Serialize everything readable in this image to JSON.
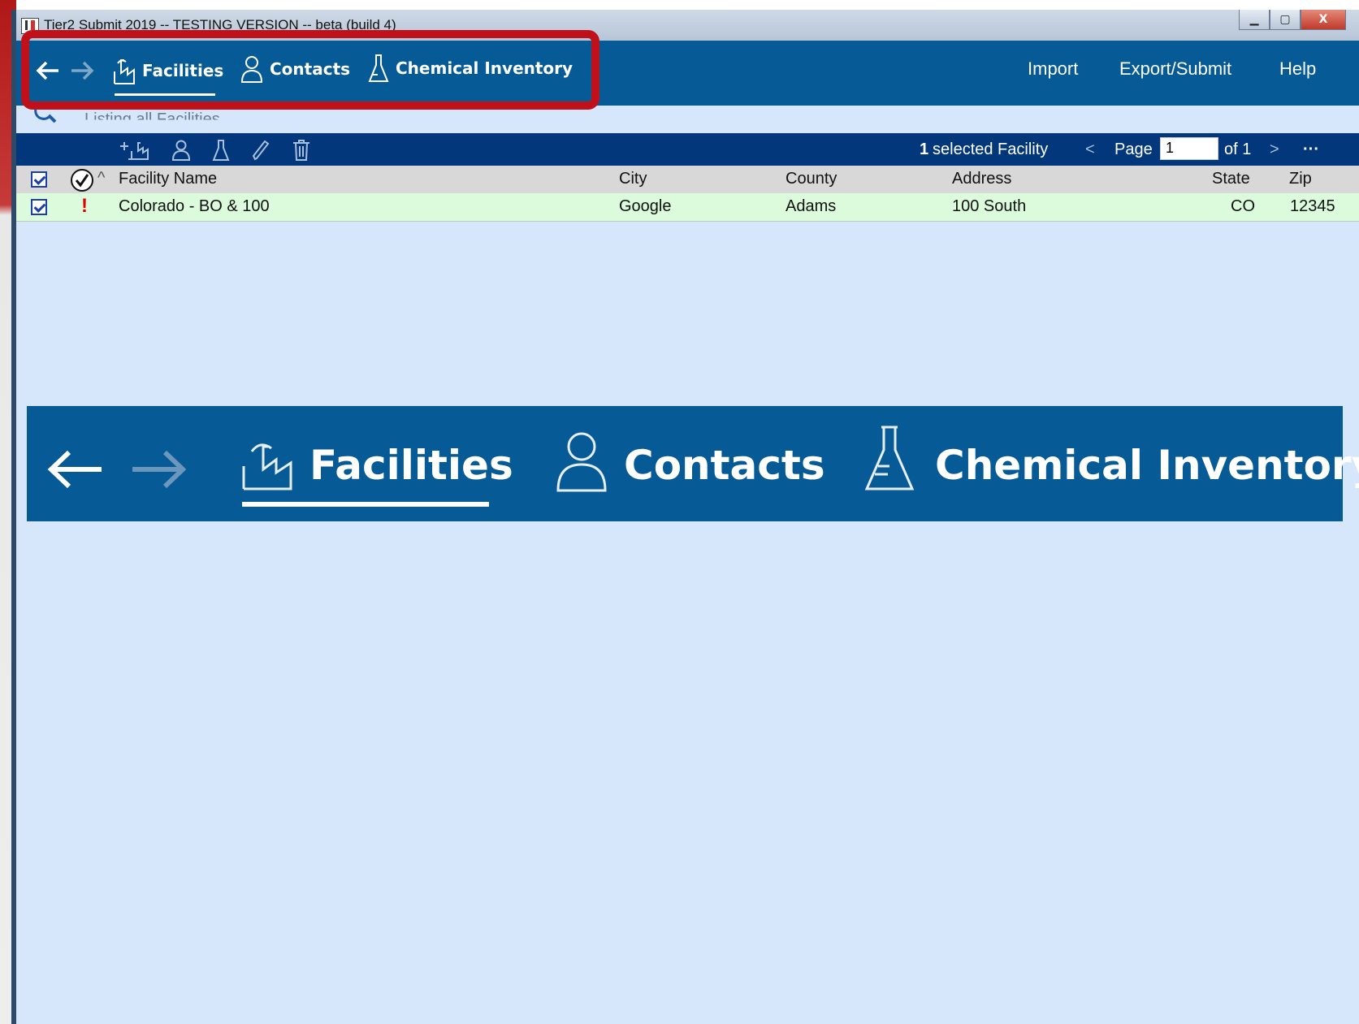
{
  "window": {
    "title": "Tier2 Submit 2019 -- TESTING VERSION -- beta (build 4)",
    "controls": {
      "minimize": "▁",
      "maximize": "▢",
      "close": "X"
    }
  },
  "nav": {
    "back": "back-arrow",
    "forward": "forward-arrow",
    "tabs": [
      {
        "label": "Facilities",
        "icon": "factory-icon",
        "active": true
      },
      {
        "label": "Contacts",
        "icon": "person-icon",
        "active": false
      },
      {
        "label": "Chemical Inventory",
        "icon": "flask-icon",
        "active": false
      }
    ],
    "menu": {
      "import": "Import",
      "export": "Export/Submit",
      "help": "Help"
    }
  },
  "search": {
    "text": "Listing all Facilities"
  },
  "toolbar": {
    "selected_count": "1",
    "selected_label": "selected Facility",
    "prev": "<",
    "page_label": "Page",
    "page_value": "1",
    "of_label": "of 1",
    "next": ">",
    "more": "···"
  },
  "table": {
    "columns": {
      "name": "Facility Name",
      "city": "City",
      "county": "County",
      "address": "Address",
      "state": "State",
      "zip": "Zip"
    },
    "sort_indicator": "^",
    "rows": [
      {
        "status": "!",
        "name": "Colorado - BO & 100",
        "city": "Google",
        "county": "Adams",
        "address": "100 South",
        "state": "CO",
        "zip": "12345",
        "checked": true
      }
    ]
  },
  "colors": {
    "nav_bg": "#065a96",
    "toolbar_bg": "#03377b",
    "content_bg": "#d6e6fb",
    "highlight": "#c0101a",
    "row_bg": "#dcfbdc"
  }
}
